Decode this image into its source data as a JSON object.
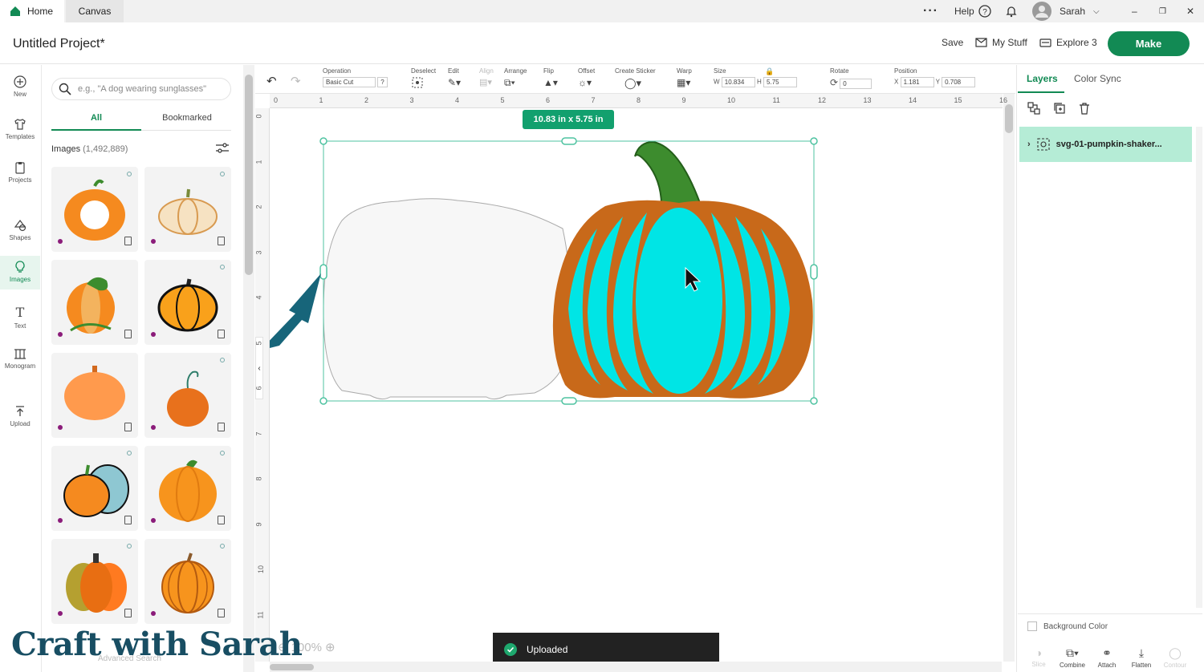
{
  "window": {
    "tabs": [
      {
        "label": "Home"
      },
      {
        "label": "Canvas"
      }
    ],
    "help_label": "Help",
    "user_name": "Sarah"
  },
  "header": {
    "project_title": "Untitled Project*",
    "save_label": "Save",
    "my_stuff_label": "My Stuff",
    "machine_label": "Explore 3",
    "make_label": "Make"
  },
  "rail": {
    "items": [
      {
        "label": "New",
        "icon": "plus-circle-icon"
      },
      {
        "label": "Templates",
        "icon": "shirt-icon"
      },
      {
        "label": "Projects",
        "icon": "clipboard-icon"
      },
      {
        "label": "Shapes",
        "icon": "shapes-icon"
      },
      {
        "label": "Images",
        "icon": "lightbulb-icon"
      },
      {
        "label": "Text",
        "icon": "text-icon"
      },
      {
        "label": "Monogram",
        "icon": "monogram-icon"
      },
      {
        "label": "Upload",
        "icon": "upload-icon"
      }
    ]
  },
  "images_panel": {
    "search_placeholder": "e.g., \"A dog wearing sunglasses\"",
    "tabs": [
      {
        "label": "All"
      },
      {
        "label": "Bookmarked"
      }
    ],
    "images_label": "Images",
    "images_count": "(1,492,889)",
    "advanced_label": "Advanced Search"
  },
  "toolbar": {
    "operation_label": "Operation",
    "operation_value": "Basic Cut",
    "deselect_label": "Deselect",
    "edit_label": "Edit",
    "align_label": "Align",
    "arrange_label": "Arrange",
    "flip_label": "Flip",
    "offset_label": "Offset",
    "create_sticker_label": "Create Sticker",
    "warp_label": "Warp",
    "size_label": "Size",
    "w_label": "W",
    "w_value": "10.834",
    "h_label": "H",
    "h_value": "5.75",
    "rotate_label": "Rotate",
    "rotate_value": "0",
    "position_label": "Position",
    "x_label": "X",
    "x_value": "1.181",
    "y_label": "Y",
    "y_value": "0.708"
  },
  "canvas": {
    "ruler_h": [
      "0",
      "1",
      "2",
      "3",
      "4",
      "5",
      "6",
      "7",
      "8",
      "9",
      "10",
      "11",
      "12",
      "13",
      "14",
      "15",
      "16"
    ],
    "ruler_v": [
      "0",
      "1",
      "2",
      "3",
      "4",
      "5",
      "6",
      "7",
      "8",
      "9",
      "10",
      "11"
    ],
    "size_badge": "10.83  in x 5.75  in",
    "zoom_label": "100%",
    "toast_label": "Uploaded",
    "colors": {
      "teal": "#00e5e5",
      "orange": "#c8691a",
      "stem": "#3d8c2e",
      "selection": "#4fc3a1"
    }
  },
  "right_panel": {
    "tabs": [
      {
        "label": "Layers"
      },
      {
        "label": "Color Sync"
      }
    ],
    "layer_name": "svg-01-pumpkin-shaker...",
    "background_color_label": "Background Color",
    "bottom_actions": [
      {
        "label": "Slice"
      },
      {
        "label": "Combine"
      },
      {
        "label": "Attach"
      },
      {
        "label": "Flatten"
      },
      {
        "label": "Contour"
      }
    ]
  },
  "watermark": "Craft with Sarah"
}
